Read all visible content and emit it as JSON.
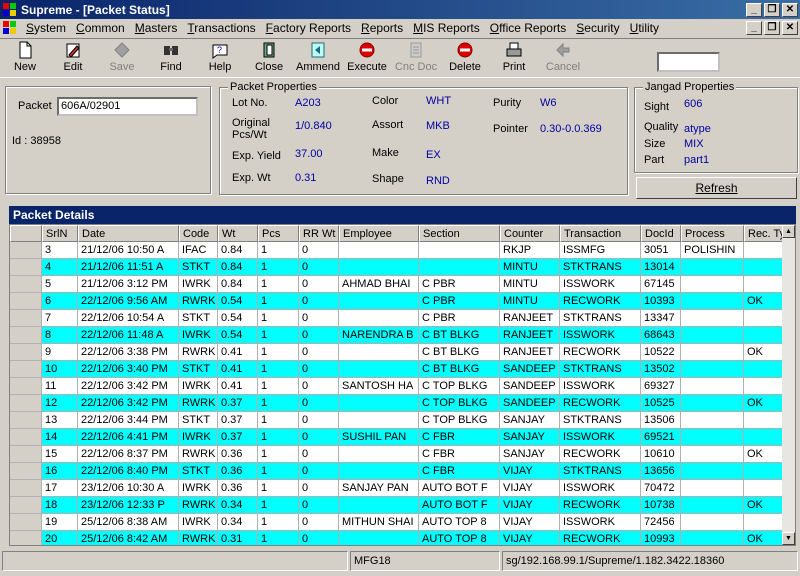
{
  "window": {
    "title": "Supreme - [Packet Status]"
  },
  "menu": [
    "System",
    "Common",
    "Masters",
    "Transactions",
    "Factory Reports",
    "Reports",
    "MIS Reports",
    "Office Reports",
    "Security",
    "Utility"
  ],
  "toolbar": [
    {
      "label": "New",
      "icon": "new-document-icon",
      "enabled": true
    },
    {
      "label": "Edit",
      "icon": "edit-icon",
      "enabled": true
    },
    {
      "label": "Save",
      "icon": "save-icon",
      "enabled": false
    },
    {
      "label": "Find",
      "icon": "find-icon",
      "enabled": true
    },
    {
      "label": "Help",
      "icon": "help-icon",
      "enabled": true
    },
    {
      "label": "Close",
      "icon": "close-door-icon",
      "enabled": true
    },
    {
      "label": "Ammend",
      "icon": "amend-icon",
      "enabled": true
    },
    {
      "label": "Execute",
      "icon": "execute-icon",
      "enabled": true
    },
    {
      "label": "Cnc Doc",
      "icon": "cancel-doc-icon",
      "enabled": false
    },
    {
      "label": "Delete",
      "icon": "delete-icon",
      "enabled": true
    },
    {
      "label": "Print",
      "icon": "print-icon",
      "enabled": true
    },
    {
      "label": "Cancel",
      "icon": "cancel-icon",
      "enabled": false
    }
  ],
  "packet": {
    "label": "Packet",
    "value": "606A/02901",
    "id_label": "Id : 38958"
  },
  "packet_props": {
    "title": "Packet Properties",
    "lot_label": "Lot No.",
    "lot": "A203",
    "orig_label_1": "Original",
    "orig_label_2": "Pcs/Wt",
    "orig": "1/0.840",
    "yield_label": "Exp. Yield",
    "yield": "37.00",
    "expwt_label": "Exp. Wt",
    "expwt": "0.31",
    "color_label": "Color",
    "color": "WHT",
    "assort_label": "Assort",
    "assort": "MKB",
    "make_label": "Make",
    "make": "EX",
    "shape_label": "Shape",
    "shape": "RND",
    "purity_label": "Purity",
    "purity": "W6",
    "pointer_label": "Pointer",
    "pointer": "0.30-0.0.369"
  },
  "jangad": {
    "title": "Jangad Properties",
    "sight_label": "Sight",
    "sight": "606",
    "quality_label": "Quality",
    "quality": "atype",
    "size_label": "Size",
    "size": "MIX",
    "part_label": "Part",
    "part": "part1"
  },
  "refresh_label": "Refresh",
  "grid": {
    "title": "Packet Details",
    "columns": [
      "SrlN",
      "Date",
      "Code",
      "Wt",
      "Pcs",
      "RR Wt",
      "Employee",
      "Section",
      "Counter",
      "Transaction",
      "DocId",
      "Process",
      "Rec. Type"
    ],
    "rows": [
      [
        "3",
        "21/12/06 10:50 A",
        "IFAC",
        "0.84",
        "1",
        "0",
        "",
        "",
        "RKJP",
        "ISSMFG",
        "3051",
        "POLISHIN",
        ""
      ],
      [
        "4",
        "21/12/06 11:51 A",
        "STKT",
        "0.84",
        "1",
        "0",
        "",
        "",
        "MINTU",
        "STKTRANS",
        "13014",
        "",
        ""
      ],
      [
        "5",
        "21/12/06 3:12 PM",
        "IWRK",
        "0.84",
        "1",
        "0",
        "AHMAD BHAI",
        "C PBR",
        "MINTU",
        "ISSWORK",
        "67145",
        "",
        ""
      ],
      [
        "6",
        "22/12/06 9:56 AM",
        "RWRK",
        "0.54",
        "1",
        "0",
        "",
        "C PBR",
        "MINTU",
        "RECWORK",
        "10393",
        "",
        "OK"
      ],
      [
        "7",
        "22/12/06 10:54 A",
        "STKT",
        "0.54",
        "1",
        "0",
        "",
        "C PBR",
        "RANJEET",
        "STKTRANS",
        "13347",
        "",
        ""
      ],
      [
        "8",
        "22/12/06 11:48 A",
        "IWRK",
        "0.54",
        "1",
        "0",
        "NARENDRA B",
        "C BT BLKG",
        "RANJEET",
        "ISSWORK",
        "68643",
        "",
        ""
      ],
      [
        "9",
        "22/12/06 3:38 PM",
        "RWRK",
        "0.41",
        "1",
        "0",
        "",
        "C BT BLKG",
        "RANJEET",
        "RECWORK",
        "10522",
        "",
        "OK"
      ],
      [
        "10",
        "22/12/06 3:40 PM",
        "STKT",
        "0.41",
        "1",
        "0",
        "",
        "C BT BLKG",
        "SANDEEP",
        "STKTRANS",
        "13502",
        "",
        ""
      ],
      [
        "11",
        "22/12/06 3:42 PM",
        "IWRK",
        "0.41",
        "1",
        "0",
        "SANTOSH HA",
        "C TOP BLKG",
        "SANDEEP",
        "ISSWORK",
        "69327",
        "",
        ""
      ],
      [
        "12",
        "22/12/06 3:42 PM",
        "RWRK",
        "0.37",
        "1",
        "0",
        "",
        "C TOP BLKG",
        "SANDEEP",
        "RECWORK",
        "10525",
        "",
        "OK"
      ],
      [
        "13",
        "22/12/06 3:44 PM",
        "STKT",
        "0.37",
        "1",
        "0",
        "",
        "C TOP BLKG",
        "SANJAY",
        "STKTRANS",
        "13506",
        "",
        ""
      ],
      [
        "14",
        "22/12/06 4:41 PM",
        "IWRK",
        "0.37",
        "1",
        "0",
        "SUSHIL PAN",
        "C FBR",
        "SANJAY",
        "ISSWORK",
        "69521",
        "",
        ""
      ],
      [
        "15",
        "22/12/06 8:37 PM",
        "RWRK",
        "0.36",
        "1",
        "0",
        "",
        "C FBR",
        "SANJAY",
        "RECWORK",
        "10610",
        "",
        "OK"
      ],
      [
        "16",
        "22/12/06 8:40 PM",
        "STKT",
        "0.36",
        "1",
        "0",
        "",
        "C FBR",
        "VIJAY",
        "STKTRANS",
        "13656",
        "",
        ""
      ],
      [
        "17",
        "23/12/06 10:30 A",
        "IWRK",
        "0.36",
        "1",
        "0",
        "SANJAY PAN",
        "AUTO BOT F",
        "VIJAY",
        "ISSWORK",
        "70472",
        "",
        ""
      ],
      [
        "18",
        "23/12/06 12:33 P",
        "RWRK",
        "0.34",
        "1",
        "0",
        "",
        "AUTO BOT F",
        "VIJAY",
        "RECWORK",
        "10738",
        "",
        "OK"
      ],
      [
        "19",
        "25/12/06 8:38 AM",
        "IWRK",
        "0.34",
        "1",
        "0",
        "MITHUN SHAI",
        "AUTO TOP 8",
        "VIJAY",
        "ISSWORK",
        "72456",
        "",
        ""
      ],
      [
        "20",
        "25/12/06 8:42 AM",
        "RWRK",
        "0.31",
        "1",
        "0",
        "",
        "AUTO TOP 8",
        "VIJAY",
        "RECWORK",
        "10993",
        "",
        "OK"
      ]
    ]
  },
  "status": {
    "mfg": "MFG18",
    "server": "sg/192.168.99.1/Supreme/1.182.3422.18360"
  },
  "colors": {
    "row_alt": "#00ffff",
    "title_bar": "#0a246a"
  }
}
